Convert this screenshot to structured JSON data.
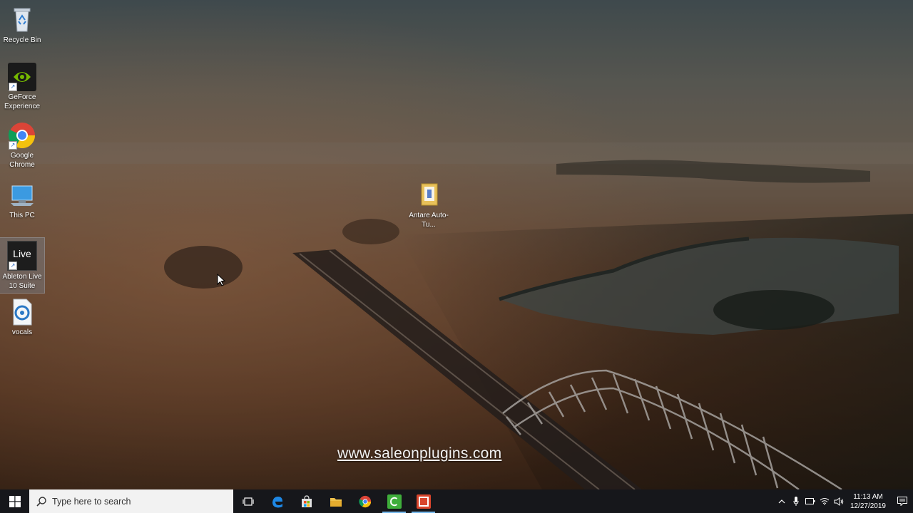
{
  "desktop": {
    "icons": [
      {
        "label": "Recycle Bin",
        "icon": "recycle-bin-icon"
      },
      {
        "label": "GeForce Experience",
        "icon": "geforce-experience-icon"
      },
      {
        "label": "Google Chrome",
        "icon": "chrome-icon"
      },
      {
        "label": "This PC",
        "icon": "this-pc-icon"
      },
      {
        "label": "Ableton Live 10 Suite",
        "icon": "ableton-live-icon",
        "glyph_text": "Live"
      },
      {
        "label": "vocals",
        "icon": "audio-file-icon"
      },
      {
        "label": "Antare Auto-Tu...",
        "icon": "folder-icon"
      }
    ]
  },
  "watermark": "www.saleonplugins.com",
  "taskbar": {
    "search_placeholder": "Type here to search",
    "pinned": [
      "start-icon",
      "task-view-icon",
      "edge-icon",
      "store-icon",
      "file-explorer-icon",
      "chrome-icon",
      "camtasia-recorder-icon",
      "camtasia-editor-icon"
    ],
    "clock_time": "11:13 AM",
    "clock_date": "12/27/2019"
  },
  "colors": {
    "taskbar": "#16171b",
    "accent": "#76b9ed",
    "camtasia_green": "#3fae3b",
    "camtasia_red": "#d9452c"
  }
}
